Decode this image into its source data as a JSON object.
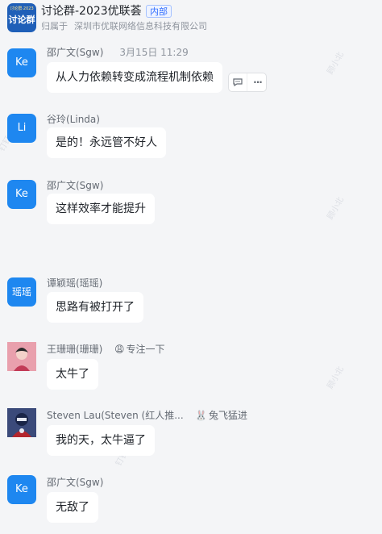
{
  "header": {
    "avatar_top": "讨论群·2023",
    "avatar_main": "讨论群",
    "title": "讨论群-2023优联荟",
    "tag": "内部",
    "belongs_label": "归属于",
    "belongs_org": "深圳市优联网络信息科技有限公司"
  },
  "messages": [
    {
      "avatar": "Ke",
      "sender": "邵广文(Sgw)",
      "time": "3月15日 11:29",
      "text": "从人力依赖转变成流程机制依赖"
    },
    {
      "avatar": "Li",
      "sender": "谷玲(Linda)",
      "text": "是的！永远管不好人"
    },
    {
      "avatar": "Ke",
      "sender": "邵广文(Sgw)",
      "text": "这样效率才能提升"
    },
    {
      "avatar": "瑶瑶",
      "sender": "谭颖瑶(瑶瑶)",
      "text": "思路有被打开了"
    },
    {
      "avatar": "",
      "sender": "王珊珊(珊珊)",
      "status_emoji": "😩",
      "status_text": "专注一下",
      "text": "太牛了"
    },
    {
      "avatar": "",
      "sender": "Steven Lau(Steven (红人推...",
      "status_emoji": "🐰",
      "status_text": "兔飞猛进",
      "text": "我的天，太牛逼了"
    },
    {
      "avatar": "Ke",
      "sender": "邵广文(Sgw)",
      "text": "无敌了"
    }
  ],
  "actions": {
    "reply_icon": "comment-icon",
    "more_label": "···"
  },
  "watermark": {
    "name": "顾小北",
    "id": "8319",
    "brand": "钉钉"
  },
  "colors": {
    "avatar_blue": "#1e87f0",
    "bg": "#f4f5f7",
    "accent": "#3370ff"
  }
}
